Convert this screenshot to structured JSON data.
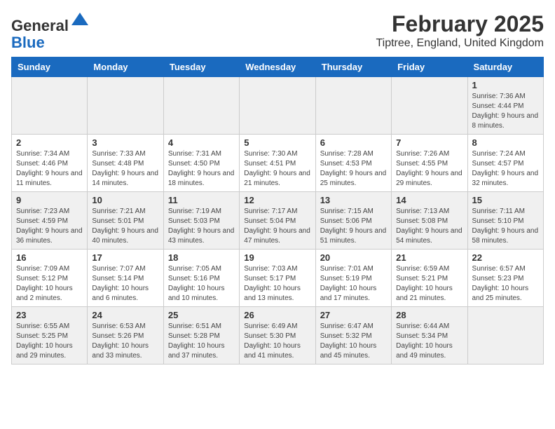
{
  "header": {
    "logo_line1": "General",
    "logo_line2": "Blue",
    "title": "February 2025",
    "subtitle": "Tiptree, England, United Kingdom"
  },
  "weekdays": [
    "Sunday",
    "Monday",
    "Tuesday",
    "Wednesday",
    "Thursday",
    "Friday",
    "Saturday"
  ],
  "weeks": [
    [
      {
        "day": "",
        "info": ""
      },
      {
        "day": "",
        "info": ""
      },
      {
        "day": "",
        "info": ""
      },
      {
        "day": "",
        "info": ""
      },
      {
        "day": "",
        "info": ""
      },
      {
        "day": "",
        "info": ""
      },
      {
        "day": "1",
        "info": "Sunrise: 7:36 AM\nSunset: 4:44 PM\nDaylight: 9 hours and 8 minutes."
      }
    ],
    [
      {
        "day": "2",
        "info": "Sunrise: 7:34 AM\nSunset: 4:46 PM\nDaylight: 9 hours and 11 minutes."
      },
      {
        "day": "3",
        "info": "Sunrise: 7:33 AM\nSunset: 4:48 PM\nDaylight: 9 hours and 14 minutes."
      },
      {
        "day": "4",
        "info": "Sunrise: 7:31 AM\nSunset: 4:50 PM\nDaylight: 9 hours and 18 minutes."
      },
      {
        "day": "5",
        "info": "Sunrise: 7:30 AM\nSunset: 4:51 PM\nDaylight: 9 hours and 21 minutes."
      },
      {
        "day": "6",
        "info": "Sunrise: 7:28 AM\nSunset: 4:53 PM\nDaylight: 9 hours and 25 minutes."
      },
      {
        "day": "7",
        "info": "Sunrise: 7:26 AM\nSunset: 4:55 PM\nDaylight: 9 hours and 29 minutes."
      },
      {
        "day": "8",
        "info": "Sunrise: 7:24 AM\nSunset: 4:57 PM\nDaylight: 9 hours and 32 minutes."
      }
    ],
    [
      {
        "day": "9",
        "info": "Sunrise: 7:23 AM\nSunset: 4:59 PM\nDaylight: 9 hours and 36 minutes."
      },
      {
        "day": "10",
        "info": "Sunrise: 7:21 AM\nSunset: 5:01 PM\nDaylight: 9 hours and 40 minutes."
      },
      {
        "day": "11",
        "info": "Sunrise: 7:19 AM\nSunset: 5:03 PM\nDaylight: 9 hours and 43 minutes."
      },
      {
        "day": "12",
        "info": "Sunrise: 7:17 AM\nSunset: 5:04 PM\nDaylight: 9 hours and 47 minutes."
      },
      {
        "day": "13",
        "info": "Sunrise: 7:15 AM\nSunset: 5:06 PM\nDaylight: 9 hours and 51 minutes."
      },
      {
        "day": "14",
        "info": "Sunrise: 7:13 AM\nSunset: 5:08 PM\nDaylight: 9 hours and 54 minutes."
      },
      {
        "day": "15",
        "info": "Sunrise: 7:11 AM\nSunset: 5:10 PM\nDaylight: 9 hours and 58 minutes."
      }
    ],
    [
      {
        "day": "16",
        "info": "Sunrise: 7:09 AM\nSunset: 5:12 PM\nDaylight: 10 hours and 2 minutes."
      },
      {
        "day": "17",
        "info": "Sunrise: 7:07 AM\nSunset: 5:14 PM\nDaylight: 10 hours and 6 minutes."
      },
      {
        "day": "18",
        "info": "Sunrise: 7:05 AM\nSunset: 5:16 PM\nDaylight: 10 hours and 10 minutes."
      },
      {
        "day": "19",
        "info": "Sunrise: 7:03 AM\nSunset: 5:17 PM\nDaylight: 10 hours and 13 minutes."
      },
      {
        "day": "20",
        "info": "Sunrise: 7:01 AM\nSunset: 5:19 PM\nDaylight: 10 hours and 17 minutes."
      },
      {
        "day": "21",
        "info": "Sunrise: 6:59 AM\nSunset: 5:21 PM\nDaylight: 10 hours and 21 minutes."
      },
      {
        "day": "22",
        "info": "Sunrise: 6:57 AM\nSunset: 5:23 PM\nDaylight: 10 hours and 25 minutes."
      }
    ],
    [
      {
        "day": "23",
        "info": "Sunrise: 6:55 AM\nSunset: 5:25 PM\nDaylight: 10 hours and 29 minutes."
      },
      {
        "day": "24",
        "info": "Sunrise: 6:53 AM\nSunset: 5:26 PM\nDaylight: 10 hours and 33 minutes."
      },
      {
        "day": "25",
        "info": "Sunrise: 6:51 AM\nSunset: 5:28 PM\nDaylight: 10 hours and 37 minutes."
      },
      {
        "day": "26",
        "info": "Sunrise: 6:49 AM\nSunset: 5:30 PM\nDaylight: 10 hours and 41 minutes."
      },
      {
        "day": "27",
        "info": "Sunrise: 6:47 AM\nSunset: 5:32 PM\nDaylight: 10 hours and 45 minutes."
      },
      {
        "day": "28",
        "info": "Sunrise: 6:44 AM\nSunset: 5:34 PM\nDaylight: 10 hours and 49 minutes."
      },
      {
        "day": "",
        "info": ""
      }
    ]
  ]
}
